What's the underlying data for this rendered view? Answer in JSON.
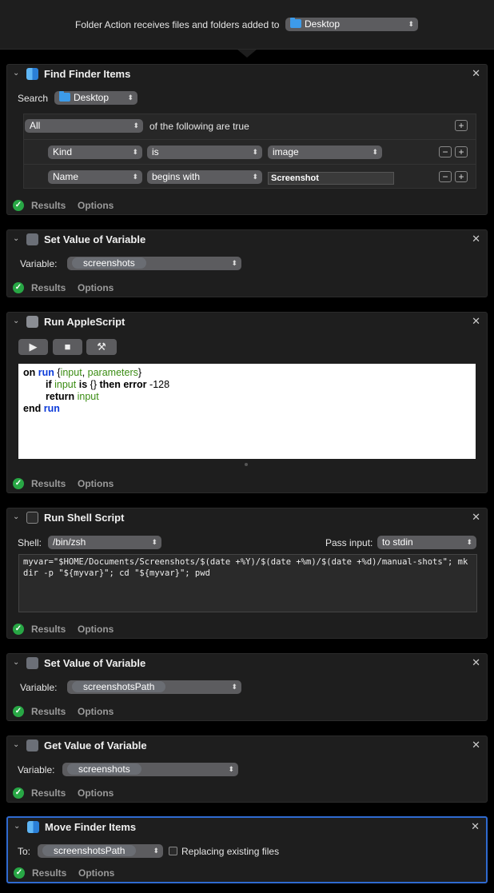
{
  "folder_action": {
    "label": "Folder Action receives files and folders added to",
    "folder": "Desktop",
    "folder_icon": "folder-icon"
  },
  "actions": {
    "find": {
      "title": "Find Finder Items",
      "search_label": "Search",
      "search_value": "Desktop",
      "match_mode": "All",
      "match_text": "of the following are true",
      "rows": [
        {
          "field": "Kind",
          "op": "is",
          "value": "image"
        },
        {
          "field": "Name",
          "op": "begins with",
          "value": "Screenshot"
        }
      ]
    },
    "set1": {
      "title": "Set Value of Variable",
      "var_label": "Variable:",
      "var_value": "screenshots"
    },
    "applescript": {
      "title": "Run AppleScript",
      "code_line1": [
        "on",
        "run",
        "{",
        "input",
        ", ",
        "parameters",
        "}"
      ],
      "code_line2": [
        "if",
        "input",
        "is",
        "{}",
        "then",
        "error",
        "-128"
      ],
      "code_line3": [
        "return",
        "input"
      ],
      "code_line4": [
        "end",
        "run"
      ]
    },
    "shell": {
      "title": "Run Shell Script",
      "shell_label": "Shell:",
      "shell_value": "/bin/zsh",
      "pass_label": "Pass input:",
      "pass_value": "to stdin",
      "code": "myvar=\"$HOME/Documents/Screenshots/$(date +%Y)/$(date +%m)/$(date +%d)/manual-shots\"; mkdir -p \"${myvar}\"; cd \"${myvar}\"; pwd"
    },
    "set2": {
      "title": "Set Value of Variable",
      "var_label": "Variable:",
      "var_value": "screenshotsPath"
    },
    "get": {
      "title": "Get Value of Variable",
      "var_label": "Variable:",
      "var_value": "screenshots"
    },
    "move": {
      "title": "Move Finder Items",
      "to_label": "To:",
      "to_value": "screenshotsPath",
      "replace_label": "Replacing existing files"
    }
  },
  "footer": {
    "results": "Results",
    "options": "Options"
  },
  "colors": {
    "accent_selected": "#2f6ad0",
    "ok_green": "#28a745",
    "keyword_blue": "#0b3ad9",
    "variable_green": "#3a8c12"
  }
}
